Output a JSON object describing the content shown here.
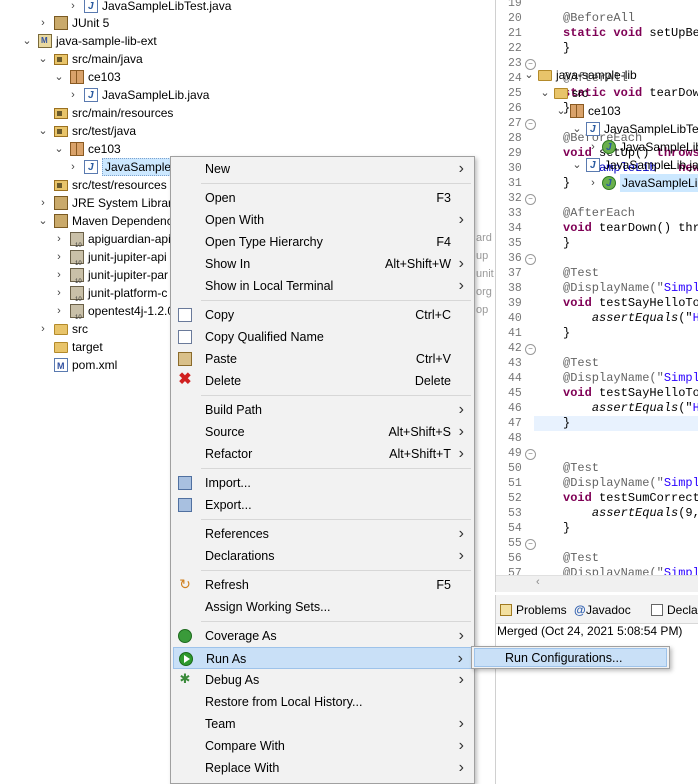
{
  "tree": {
    "items": [
      {
        "label": "JavaSampleLibTest.java",
        "icon": "java-file-icon",
        "toggle": "›"
      },
      {
        "label": "JUnit 5",
        "icon": "library-icon",
        "toggle": "›"
      },
      {
        "label": "java-sample-lib-ext",
        "icon": "maven-project-icon",
        "toggle": "⌄"
      },
      {
        "label": "src/main/java",
        "icon": "source-folder-icon",
        "toggle": "⌄"
      },
      {
        "label": "ce103",
        "icon": "package-icon",
        "toggle": "⌄"
      },
      {
        "label": "JavaSampleLib.java",
        "icon": "java-file-icon",
        "toggle": "›"
      },
      {
        "label": "src/main/resources",
        "icon": "source-folder-icon",
        "toggle": ""
      },
      {
        "label": "src/test/java",
        "icon": "source-folder-icon",
        "toggle": "⌄"
      },
      {
        "label": "ce103",
        "icon": "package-icon",
        "toggle": "⌄"
      },
      {
        "label": "JavaSampleL",
        "icon": "java-file-icon",
        "toggle": "›"
      },
      {
        "label": "src/test/resources",
        "icon": "source-folder-icon",
        "toggle": ""
      },
      {
        "label": "JRE System Library",
        "icon": "library-icon",
        "toggle": "›"
      },
      {
        "label": "Maven Dependenc",
        "icon": "library-icon",
        "toggle": "⌄"
      },
      {
        "label": "apiguardian-api",
        "icon": "jar-icon",
        "toggle": "›"
      },
      {
        "label": "junit-jupiter-api",
        "icon": "jar-icon",
        "toggle": "›"
      },
      {
        "label": "junit-jupiter-par",
        "icon": "jar-icon",
        "toggle": "›"
      },
      {
        "label": "junit-platform-c",
        "icon": "jar-icon",
        "toggle": "›"
      },
      {
        "label": "opentest4j-1.2.0",
        "icon": "jar-icon",
        "toggle": "›"
      },
      {
        "label": "src",
        "icon": "folder-icon",
        "toggle": "›"
      },
      {
        "label": "target",
        "icon": "folder-icon",
        "toggle": ""
      },
      {
        "label": "pom.xml",
        "icon": "pom-file-icon",
        "toggle": ""
      }
    ],
    "faded_suffixes": [
      "ard",
      "up",
      "unit",
      "org",
      "op"
    ]
  },
  "editor": {
    "lines": [
      {
        "n": "19",
        "fold": "",
        "text": ""
      },
      {
        "n": "20",
        "fold": "",
        "text": "@BeforeAll"
      },
      {
        "n": "21",
        "fold": "",
        "text": "static void setUpBef"
      },
      {
        "n": "22",
        "fold": "",
        "text": "}"
      },
      {
        "n": "23",
        "fold": "⊖",
        "text": ""
      },
      {
        "n": "24",
        "fold": "",
        "text": "@AfterAll"
      },
      {
        "n": "25",
        "fold": "",
        "text": "static void tearDown"
      },
      {
        "n": "26",
        "fold": "",
        "text": "}"
      },
      {
        "n": "27",
        "fold": "⊖",
        "text": ""
      },
      {
        "n": "28",
        "fold": "",
        "text": "@BeforeEach"
      },
      {
        "n": "29",
        "fold": "",
        "text": "void setUp() throws"
      },
      {
        "n": "30",
        "fold": "",
        "text": "    sampleLib = new"
      },
      {
        "n": "31",
        "fold": "",
        "text": "}"
      },
      {
        "n": "32",
        "fold": "⊖",
        "text": ""
      },
      {
        "n": "33",
        "fold": "",
        "text": "@AfterEach"
      },
      {
        "n": "34",
        "fold": "",
        "text": "void tearDown() thro"
      },
      {
        "n": "35",
        "fold": "",
        "text": "}"
      },
      {
        "n": "36",
        "fold": "⊖",
        "text": ""
      },
      {
        "n": "37",
        "fold": "",
        "text": "@Test"
      },
      {
        "n": "38",
        "fold": "",
        "text": "@DisplayName(\"Simple"
      },
      {
        "n": "39",
        "fold": "",
        "text": "void testSayHelloTo"
      },
      {
        "n": "40",
        "fold": "",
        "text": "    assertEquals(\"He"
      },
      {
        "n": "41",
        "fold": "",
        "text": "}"
      },
      {
        "n": "42",
        "fold": "⊖",
        "text": ""
      },
      {
        "n": "43",
        "fold": "",
        "text": "@Test"
      },
      {
        "n": "44",
        "fold": "",
        "text": "@DisplayName(\"Simple"
      },
      {
        "n": "45",
        "fold": "",
        "text": "void testSayHelloTo"
      },
      {
        "n": "46",
        "fold": "",
        "text": "    assertEquals(\"He"
      },
      {
        "n": "47",
        "fold": "",
        "text": "}"
      },
      {
        "n": "48",
        "fold": "",
        "text": ""
      },
      {
        "n": "49",
        "fold": "⊖",
        "text": ""
      },
      {
        "n": "50",
        "fold": "",
        "text": "@Test"
      },
      {
        "n": "51",
        "fold": "",
        "text": "@DisplayName(\"Simple"
      },
      {
        "n": "52",
        "fold": "",
        "text": "void testSumCorrect("
      },
      {
        "n": "53",
        "fold": "",
        "text": "    assertEquals(9,"
      },
      {
        "n": "54",
        "fold": "",
        "text": "}"
      },
      {
        "n": "55",
        "fold": "⊖",
        "text": ""
      },
      {
        "n": "56",
        "fold": "",
        "text": "@Test"
      },
      {
        "n": "57",
        "fold": "",
        "text": "@DisplayName(\"Simple"
      }
    ]
  },
  "bottom_panel": {
    "tabs": [
      {
        "label": "Problems",
        "icon": "problems-icon"
      },
      {
        "label": "Javadoc",
        "icon": "javadoc-icon"
      },
      {
        "label": "Decla",
        "icon": "declaration-icon"
      }
    ],
    "merged_label": "Merged (Oct 24, 2021 5:08:54 PM)",
    "tree": [
      {
        "label": "java-sample-lib",
        "icon": "folder-icon",
        "toggle": "⌄"
      },
      {
        "label": "src",
        "icon": "folder-icon",
        "toggle": "⌄"
      },
      {
        "label": "ce103",
        "icon": "package-icon",
        "toggle": "⌄"
      },
      {
        "label": "JavaSampleLibTest.jav",
        "icon": "java-file-icon",
        "toggle": "⌄"
      },
      {
        "label": "JavaSampleLibTest",
        "icon": "class-icon",
        "toggle": "›"
      },
      {
        "label": "JavaSampleLib.java",
        "icon": "java-file-icon",
        "toggle": "⌄"
      },
      {
        "label": "JavaSampleLib",
        "icon": "class-icon",
        "toggle": "›"
      }
    ]
  },
  "context_menu": {
    "items": [
      {
        "label": "New",
        "shortcut": "",
        "arrow": true,
        "icon": ""
      },
      {
        "sep": true
      },
      {
        "label": "Open",
        "shortcut": "F3",
        "arrow": false,
        "icon": ""
      },
      {
        "label": "Open With",
        "shortcut": "",
        "arrow": true,
        "icon": ""
      },
      {
        "label": "Open Type Hierarchy",
        "shortcut": "F4",
        "arrow": false,
        "icon": ""
      },
      {
        "label": "Show In",
        "shortcut": "Alt+Shift+W",
        "arrow": true,
        "icon": ""
      },
      {
        "label": "Show in Local Terminal",
        "shortcut": "",
        "arrow": true,
        "icon": ""
      },
      {
        "sep": true
      },
      {
        "label": "Copy",
        "shortcut": "Ctrl+C",
        "arrow": false,
        "icon": "copy-icon"
      },
      {
        "label": "Copy Qualified Name",
        "shortcut": "",
        "arrow": false,
        "icon": "copy-qualified-icon"
      },
      {
        "label": "Paste",
        "shortcut": "Ctrl+V",
        "arrow": false,
        "icon": "paste-icon"
      },
      {
        "label": "Delete",
        "shortcut": "Delete",
        "arrow": false,
        "icon": "delete-icon"
      },
      {
        "sep": true
      },
      {
        "label": "Build Path",
        "shortcut": "",
        "arrow": true,
        "icon": ""
      },
      {
        "label": "Source",
        "shortcut": "Alt+Shift+S",
        "arrow": true,
        "icon": ""
      },
      {
        "label": "Refactor",
        "shortcut": "Alt+Shift+T",
        "arrow": true,
        "icon": ""
      },
      {
        "sep": true
      },
      {
        "label": "Import...",
        "shortcut": "",
        "arrow": false,
        "icon": "import-icon"
      },
      {
        "label": "Export...",
        "shortcut": "",
        "arrow": false,
        "icon": "export-icon"
      },
      {
        "sep": true
      },
      {
        "label": "References",
        "shortcut": "",
        "arrow": true,
        "icon": ""
      },
      {
        "label": "Declarations",
        "shortcut": "",
        "arrow": true,
        "icon": ""
      },
      {
        "sep": true
      },
      {
        "label": "Refresh",
        "shortcut": "F5",
        "arrow": false,
        "icon": "refresh-icon"
      },
      {
        "label": "Assign Working Sets...",
        "shortcut": "",
        "arrow": false,
        "icon": ""
      },
      {
        "sep": true
      },
      {
        "label": "Coverage As",
        "shortcut": "",
        "arrow": true,
        "icon": "coverage-icon"
      },
      {
        "label": "Run As",
        "shortcut": "",
        "arrow": true,
        "icon": "run-icon",
        "highlight": true
      },
      {
        "label": "Debug As",
        "shortcut": "",
        "arrow": true,
        "icon": "debug-icon"
      },
      {
        "label": "Restore from Local History...",
        "shortcut": "",
        "arrow": false,
        "icon": ""
      },
      {
        "label": "Team",
        "shortcut": "",
        "arrow": true,
        "icon": ""
      },
      {
        "label": "Compare With",
        "shortcut": "",
        "arrow": true,
        "icon": ""
      },
      {
        "label": "Replace With",
        "shortcut": "",
        "arrow": true,
        "icon": ""
      }
    ]
  },
  "submenu": {
    "items": [
      {
        "label": "Run Configurations..."
      }
    ]
  },
  "colors": {
    "selection": "#cce8ff",
    "menu_bg": "#f2f2f2",
    "menu_highlight": "#c9e0f7",
    "keyword": "#7f0055",
    "string": "#2a00ff",
    "annotation": "#646464"
  }
}
